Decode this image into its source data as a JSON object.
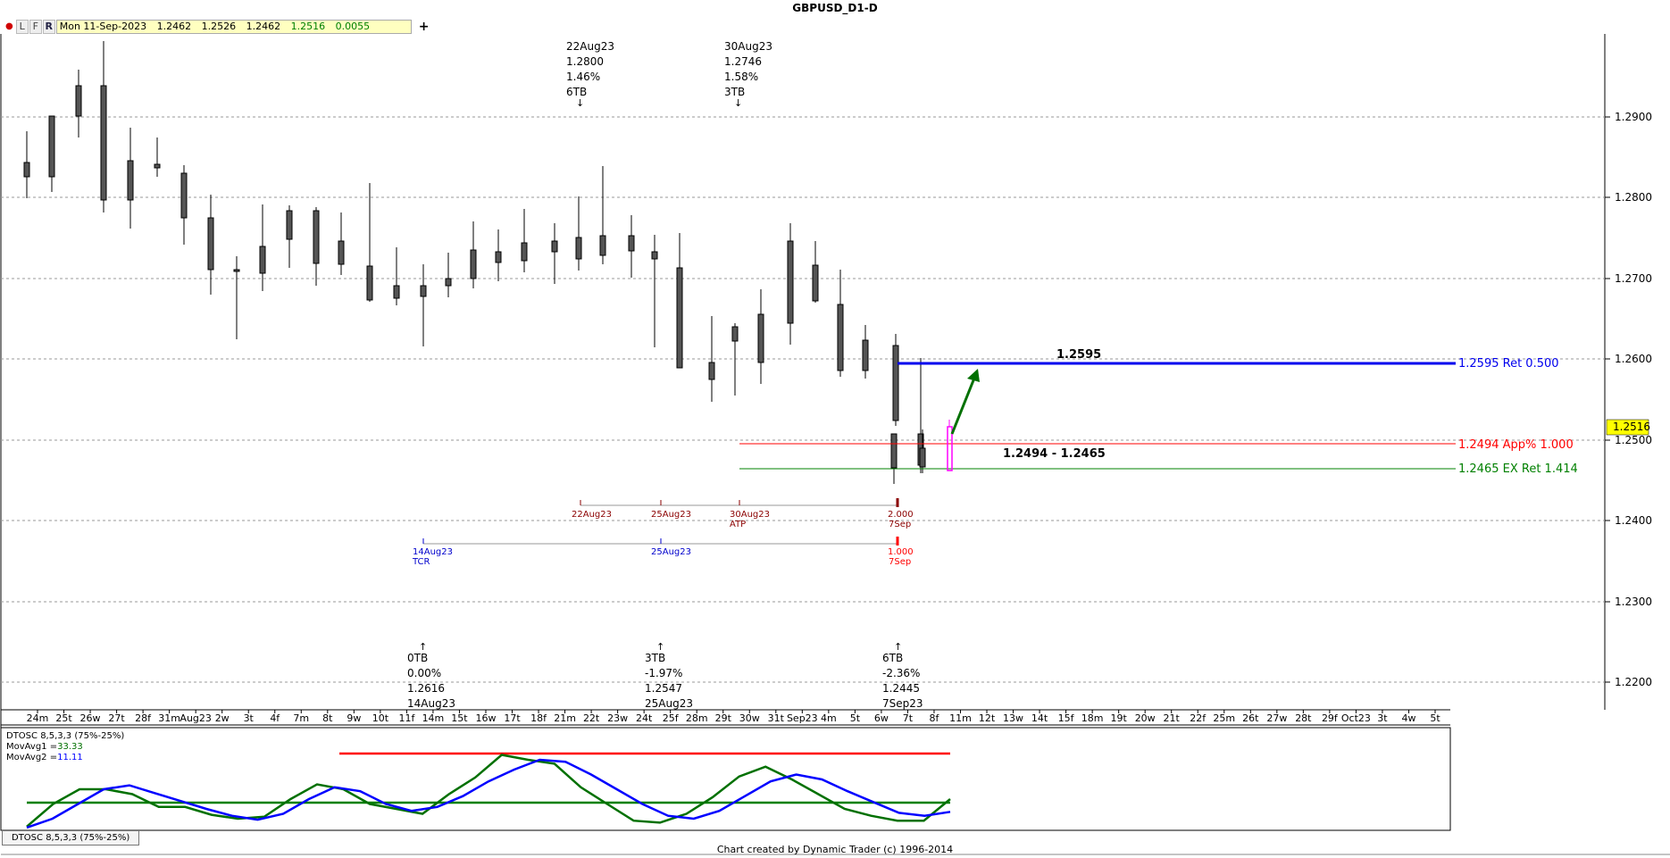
{
  "window": {
    "title": "GBPUSD_D1-D"
  },
  "toolbar": {
    "buttons": [
      "L",
      "F",
      "R"
    ],
    "info": {
      "date": "Mon 11-Sep-2023",
      "open": "1.2462",
      "high": "1.2526",
      "low": "1.2462",
      "close": "1.2516",
      "change": "0.0055"
    },
    "add_label": "+"
  },
  "price_axis": {
    "ticks": [
      "1.2900",
      "1.2800",
      "1.2700",
      "1.2600",
      "1.2500",
      "1.2400",
      "1.2300",
      "1.2200"
    ],
    "current_price": "1.2516",
    "current_price_color": "#ffff00"
  },
  "date_axis": {
    "labels": [
      "24m",
      "25t",
      "26w",
      "27t",
      "28f",
      "31m",
      "Aug23",
      "2w",
      "3t",
      "4f",
      "7m",
      "8t",
      "9w",
      "10t",
      "11f",
      "14m",
      "15t",
      "16w",
      "17t",
      "18f",
      "21m",
      "22t",
      "23w",
      "24t",
      "25f",
      "28m",
      "29t",
      "30w",
      "31t",
      "Sep23",
      "4m",
      "5t",
      "6w",
      "7t",
      "8f",
      "11m",
      "12t",
      "13w",
      "14t",
      "15f",
      "18m",
      "19t",
      "20w",
      "21t",
      "22f",
      "25m",
      "26t",
      "27w",
      "28t",
      "29f",
      "Oct23",
      "3t",
      "4w",
      "5t"
    ]
  },
  "levels": [
    {
      "id": "ret500",
      "label": "1.2595 Ret 0.500",
      "color": "#0000ee",
      "top_label": "1.2595"
    },
    {
      "id": "app100",
      "label": "1.2494 App% 1.000",
      "color": "#ff0000"
    },
    {
      "id": "ex1414",
      "label": "1.2465 EX Ret 1.414",
      "color": "#008000"
    }
  ],
  "zone_label": "1.2494 - 1.2465",
  "top_annotations": [
    {
      "lines": [
        "22Aug23",
        "1.2800",
        "1.46%",
        "6TB"
      ],
      "arrow": "↓"
    },
    {
      "lines": [
        "30Aug23",
        "1.2746",
        "1.58%",
        "3TB"
      ],
      "arrow": "↓"
    }
  ],
  "bottom_annotations": [
    {
      "lines": [
        "0TB",
        "0.00%",
        "1.2616",
        "14Aug23"
      ],
      "arrow": "↑"
    },
    {
      "lines": [
        "3TB",
        "-1.97%",
        "1.2547",
        "25Aug23"
      ],
      "arrow": "↑"
    },
    {
      "lines": [
        "6TB",
        "-2.36%",
        "1.2445",
        "7Sep23"
      ],
      "arrow": "↑"
    }
  ],
  "time_projections": {
    "row1": {
      "labels": [
        "22Aug23",
        "25Aug23",
        "30Aug23",
        "ATP"
      ],
      "end": [
        "2.000",
        "7Sep"
      ],
      "color": "#8b0000"
    },
    "row2": {
      "labels": [
        "14Aug23",
        "TCR",
        "25Aug23"
      ],
      "end": [
        "1.000",
        "7Sep"
      ],
      "color": "#0000cc",
      "end_color": "#ff0000"
    }
  },
  "indicator": {
    "name": "DTOSC 8,5,3,3 (75%-25%)",
    "ma1_label": "MovAvg1 =",
    "ma1_value": "33.33",
    "ma1_color": "#007000",
    "ma2_label": "MovAvg2 =",
    "ma2_value": "11.11",
    "ma2_color": "#0000ff",
    "upper_band": 75,
    "lower_band": 25,
    "fast": [
      2,
      25,
      40,
      40,
      35,
      22,
      22,
      14,
      10,
      12,
      30,
      45,
      40,
      25,
      20,
      15,
      35,
      52,
      75,
      70,
      66,
      42,
      25,
      8,
      6,
      15,
      32,
      53,
      63,
      50,
      35,
      20,
      13,
      8,
      8,
      30
    ],
    "slow": [
      1,
      10,
      25,
      40,
      44,
      36,
      28,
      20,
      13,
      9,
      15,
      30,
      42,
      38,
      25,
      18,
      22,
      33,
      48,
      60,
      70,
      68,
      55,
      40,
      25,
      13,
      10,
      18,
      33,
      48,
      55,
      50,
      38,
      27,
      16,
      13,
      17
    ]
  },
  "tab": {
    "label": "DTOSC 8,5,3,3 (75%-25%)"
  },
  "footer": {
    "text": "Chart created by Dynamic Trader  (c) 1996-2014"
  }
}
